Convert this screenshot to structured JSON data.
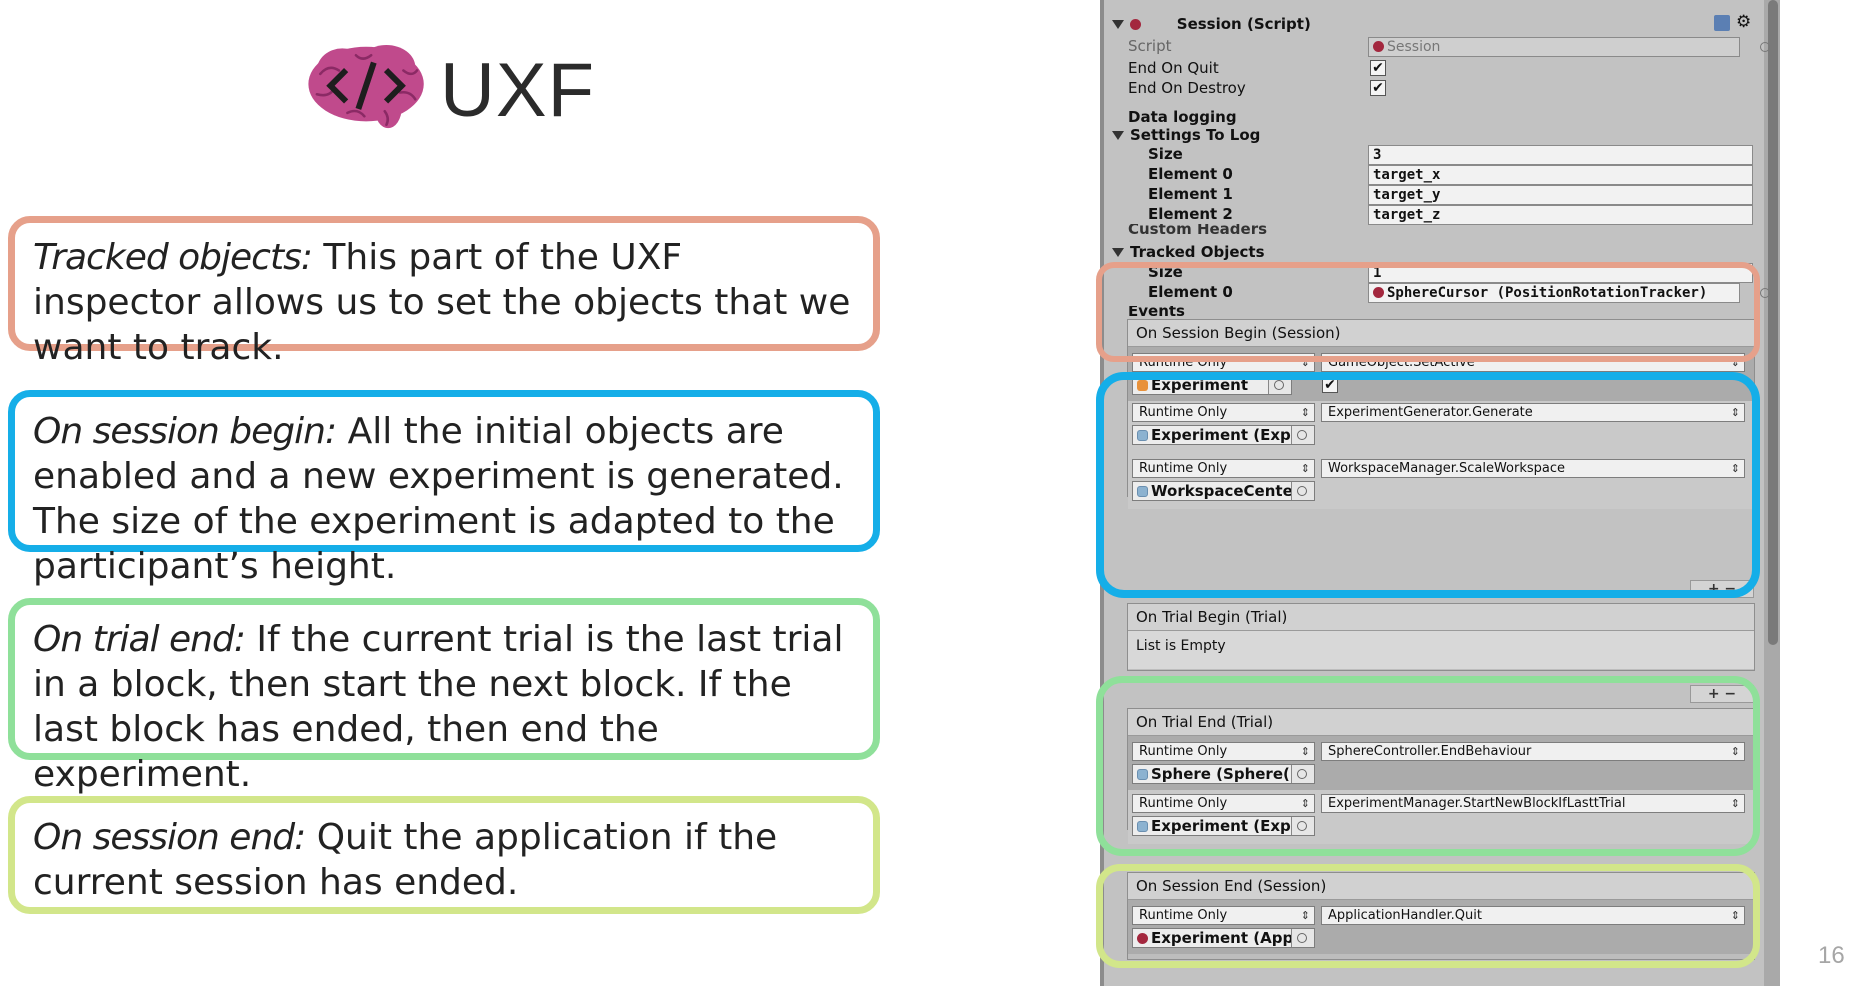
{
  "logo": {
    "text": "UXF",
    "icon": "brain-code-icon",
    "color": "#c04a8c"
  },
  "callouts": [
    {
      "title": "Tracked objects:",
      "text": "This part of the UXF inspector allows us to set the objects that we want to track.",
      "color": "#e6a08a"
    },
    {
      "title": "On session begin:",
      "text": "All the initial objects are enabled and a new experiment is generated. The size of the experiment is adapted to the participant’s height.",
      "color": "#15aee8"
    },
    {
      "title": "On trial end:",
      "text": "If the current trial is the last trial in a block, then start the next block. If the last block has ended, then end the experiment.",
      "color": "#8fe09a"
    },
    {
      "title": "On session end:",
      "text": "Quit the application if the current session has ended.",
      "color": "#d2e68a"
    }
  ],
  "page_number": "16",
  "inspector": {
    "component_title": "Session (Script)",
    "script_label": "Script",
    "script_value": "Session",
    "end_on_quit": "End On Quit",
    "end_on_destroy": "End On Destroy",
    "check": "✔",
    "data_logging": "Data logging",
    "settings_to_log": "Settings To Log",
    "settings_size_label": "Size",
    "settings_size": "3",
    "elements": [
      {
        "label": "Element 0",
        "value": "target_x"
      },
      {
        "label": "Element 1",
        "value": "target_y"
      },
      {
        "label": "Element 2",
        "value": "target_z"
      }
    ],
    "custom_headers": "Custom Headers",
    "tracked_objects": "Tracked Objects",
    "tracked_size_label": "Size",
    "tracked_size": "1",
    "tracked_element_label": "Element 0",
    "tracked_element_value": "SphereCursor (PositionRotationTracker)",
    "events_label": "Events",
    "plus_minus": "+  −",
    "events": {
      "session_begin": {
        "header": "On Session Begin (Session)",
        "listeners": [
          {
            "mode": "Runtime Only",
            "function": "GameObject.SetActive",
            "object": "Experiment",
            "checked": "✔"
          },
          {
            "mode": "Runtime Only",
            "function": "ExperimentGenerator.Generate",
            "object": "Experiment (Exp"
          },
          {
            "mode": "Runtime Only",
            "function": "WorkspaceManager.ScaleWorkspace",
            "object": "WorkspaceCente"
          }
        ]
      },
      "trial_begin": {
        "header": "On Trial Begin (Trial)",
        "empty": "List is Empty"
      },
      "trial_end": {
        "header": "On Trial End (Trial)",
        "listeners": [
          {
            "mode": "Runtime Only",
            "function": "SphereController.EndBehaviour",
            "object": "Sphere (Sphere("
          },
          {
            "mode": "Runtime Only",
            "function": "ExperimentManager.StartNewBlockIfLasttTrial",
            "object": "Experiment (Exp"
          }
        ]
      },
      "session_end": {
        "header": "On Session End (Session)",
        "listeners": [
          {
            "mode": "Runtime Only",
            "function": "ApplicationHandler.Quit",
            "object": "Experiment (App"
          }
        ]
      }
    }
  }
}
